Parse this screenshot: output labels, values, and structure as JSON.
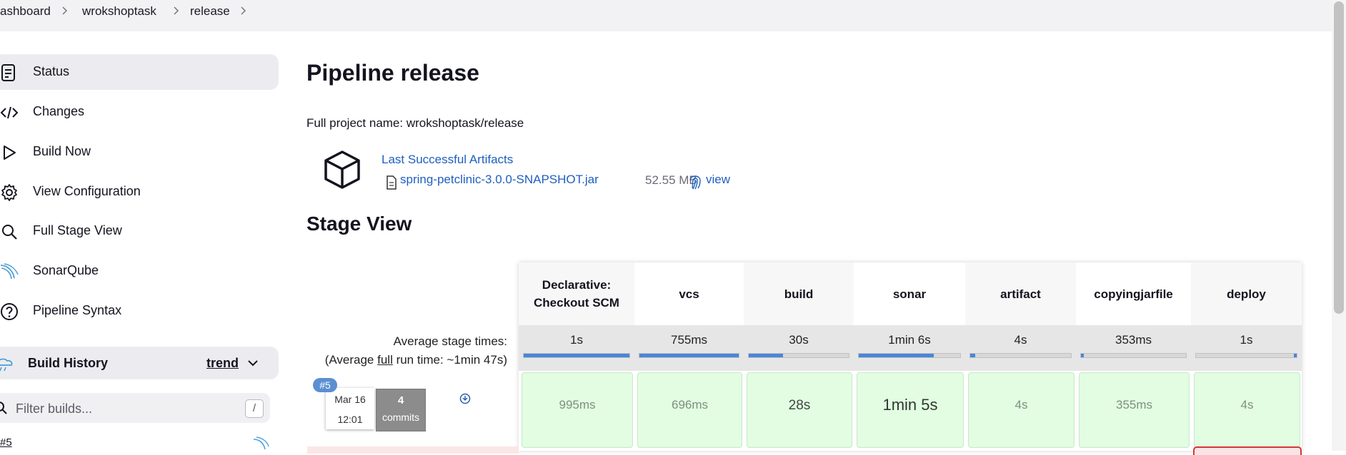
{
  "breadcrumb": {
    "items": [
      "ashboard",
      "wrokshoptask",
      "release"
    ]
  },
  "sidebar": {
    "items": [
      {
        "label": "Status",
        "icon": "status-document-icon"
      },
      {
        "label": "Changes",
        "icon": "code-icon"
      },
      {
        "label": "Build Now",
        "icon": "play-icon"
      },
      {
        "label": "View Configuration",
        "icon": "gear-icon"
      },
      {
        "label": "Full Stage View",
        "icon": "search-icon"
      },
      {
        "label": "SonarQube",
        "icon": "sonarqube-icon"
      },
      {
        "label": "Pipeline Syntax",
        "icon": "help-icon"
      }
    ],
    "build_history": {
      "title": "Build History",
      "trend_label": "trend",
      "filter_placeholder": "Filter builds...",
      "filter_shortcut": "/",
      "first_item": "#5"
    }
  },
  "main": {
    "title": "Pipeline release",
    "full_name": "Full project name: wrokshoptask/release",
    "artifacts": {
      "heading": "Last Successful Artifacts",
      "file": "spring-petclinic-3.0.0-SNAPSHOT.jar",
      "size": "52.55 MB",
      "view_label": "view"
    },
    "stage_view_title": "Stage View"
  },
  "stage_view": {
    "avg_label_line1": "Average stage times:",
    "avg_label_prefix": "(Average ",
    "avg_label_link": "full",
    "avg_label_suffix": " run time: ~1min 47s)",
    "stages": [
      {
        "name": "Declarative: Checkout SCM",
        "avg": "1s",
        "avg_fraction": 1.0,
        "run": "995ms"
      },
      {
        "name": "vcs",
        "avg": "755ms",
        "avg_fraction": 1.0,
        "run": "696ms"
      },
      {
        "name": "build",
        "avg": "30s",
        "avg_fraction": 0.34,
        "run": "28s"
      },
      {
        "name": "sonar",
        "avg": "1min 6s",
        "avg_fraction": 0.74,
        "run": "1min 5s"
      },
      {
        "name": "artifact",
        "avg": "4s",
        "avg_fraction": 0.05,
        "run": "4s"
      },
      {
        "name": "copyingjarfile",
        "avg": "353ms",
        "avg_fraction": 0.03,
        "run": "355ms"
      },
      {
        "name": "deploy",
        "avg": "1s",
        "avg_fraction": 0.03,
        "run": "4s"
      }
    ],
    "build": {
      "number": "#5",
      "date": "Mar 16",
      "time": "12:01",
      "commits_count": "4",
      "commits_label": "commits"
    }
  },
  "colors": {
    "accent_link": "#1f5fbf",
    "success_cell": "#e2fde2",
    "progress_fill": "#4a86d8",
    "failed_border": "#d23838"
  }
}
